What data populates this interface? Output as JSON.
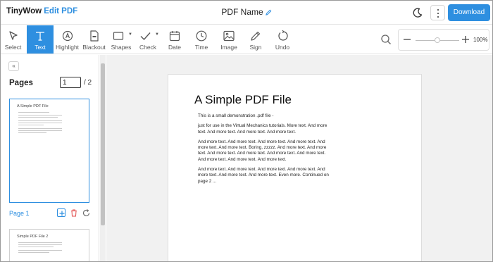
{
  "header": {
    "brand_main": "TinyWow",
    "brand_accent": "Edit PDF",
    "doc_name": "PDF Name",
    "download_label": "Download",
    "accent_color": "#2e8fe0"
  },
  "toolbar": {
    "tools": [
      {
        "label": "Select",
        "icon": "cursor-icon",
        "active": false
      },
      {
        "label": "Text",
        "icon": "text-icon",
        "active": true
      },
      {
        "label": "Highlight",
        "icon": "highlight-icon",
        "active": false
      },
      {
        "label": "Blackout",
        "icon": "blackout-icon",
        "active": false
      },
      {
        "label": "Shapes",
        "icon": "shapes-icon",
        "active": false
      },
      {
        "label": "Check",
        "icon": "check-icon",
        "active": false
      },
      {
        "label": "Date",
        "icon": "calendar-icon",
        "active": false
      },
      {
        "label": "Time",
        "icon": "clock-icon",
        "active": false
      },
      {
        "label": "Image",
        "icon": "image-icon",
        "active": false
      },
      {
        "label": "Sign",
        "icon": "pen-icon",
        "active": false
      },
      {
        "label": "Undo",
        "icon": "undo-icon",
        "active": false
      }
    ],
    "zoom_value": "100%",
    "zoom_fraction": 0.5
  },
  "sidebar": {
    "collapse_label": "«",
    "title": "Pages",
    "current_page": "1",
    "total_pages": "/ 2",
    "page_label": "Page 1",
    "thumb1_title": "A Simple PDF File",
    "thumb2_title": "Simple PDF File 2"
  },
  "document": {
    "title": "A Simple PDF File",
    "paragraphs": [
      "This is a small demonstration .pdf file -",
      "just for use in the Virtual Mechanics tutorials. More text. And more text. And more text. And more text. And more text.",
      "And more text. And more text. And more text. And more text. And more text. And more text. Boring, zzzzz. And more text. And more text. And more text. And more text. And more text. And more text. And more text. And more text. And more text.",
      "And more text. And more text. And more text. And more text. And more text. And more text. And more text. Even more. Continued on page 2 ..."
    ]
  }
}
